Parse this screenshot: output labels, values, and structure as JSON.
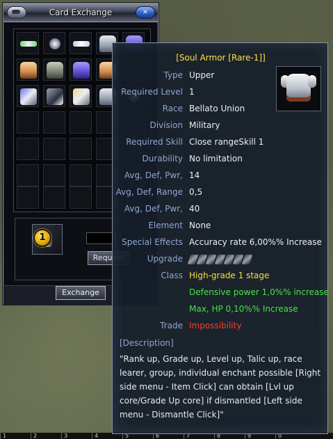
{
  "window": {
    "title": "Card Exchange",
    "close_glyph": "⨯",
    "quantity_value": "1",
    "request_label": "Request",
    "exchange_label": "Exchange",
    "slot_badge": "1"
  },
  "grid": {
    "items": [
      "bar-green-item",
      "small-orb-item",
      "bar-white-item",
      "armor-upper-white-item",
      "armor-upper-purple-item",
      "armor-upper-orange-item",
      "armor-upper-grey-item",
      "armor-lower-purple-item",
      "armor-lower-orange-item",
      "empty-slot",
      "boots-purple-item",
      "gloves-item",
      "boots-gold-item",
      "boots-white-item",
      "small-sword-item"
    ]
  },
  "hotbar": {
    "keys": [
      "1",
      "2",
      "3",
      "4",
      "5",
      "6",
      "7",
      "8",
      "9",
      "0"
    ]
  },
  "tooltip": {
    "title": "[Soul Armor [Rare-1]]",
    "rows": [
      {
        "k": "Type",
        "v": "Upper"
      },
      {
        "k": "Required Level",
        "v": "1"
      },
      {
        "k": "Race",
        "v": "Bellato Union"
      },
      {
        "k": "Division",
        "v": "Military"
      },
      {
        "k": "Required Skill",
        "v": "Close rangeSkill 1"
      },
      {
        "k": "Durability",
        "v": "No limitation"
      },
      {
        "k": "Avg, Def, Pwr,",
        "v": "14"
      },
      {
        "k": "Avg, Def, Range",
        "v": "0,5"
      },
      {
        "k": "Avg, Def, Pwr,",
        "v": "40"
      },
      {
        "k": "Element",
        "v": "None"
      },
      {
        "k": "Special Effects",
        "v": "Accuracy rate 6,00%% Increase"
      },
      {
        "k": "Upgrade",
        "v": ""
      },
      {
        "k": "Class",
        "v": "High-grade 1 stage"
      },
      {
        "k": "",
        "v": "Defensive power 1,0%% increase"
      },
      {
        "k": "",
        "v": "Max, HP 0,10%% Increase"
      },
      {
        "k": "Trade",
        "v": "Impossibility"
      }
    ],
    "upgrade_slots": 7,
    "description_header": "[Description]",
    "description": "\"Rank up, Grade up, Level up, Talic up, race learer, group, individual enchant possible [Right side menu - Item Click] can obtain [Lvl up core/Grade Up core] if dismantled [Left side menu - Dismantle Click]\"",
    "colors": {
      "title": "#ffe24a",
      "label": "#8fa7d0",
      "class": "#f3e03c",
      "bonus": "#46e346",
      "trade": "#ff3b2f"
    }
  }
}
